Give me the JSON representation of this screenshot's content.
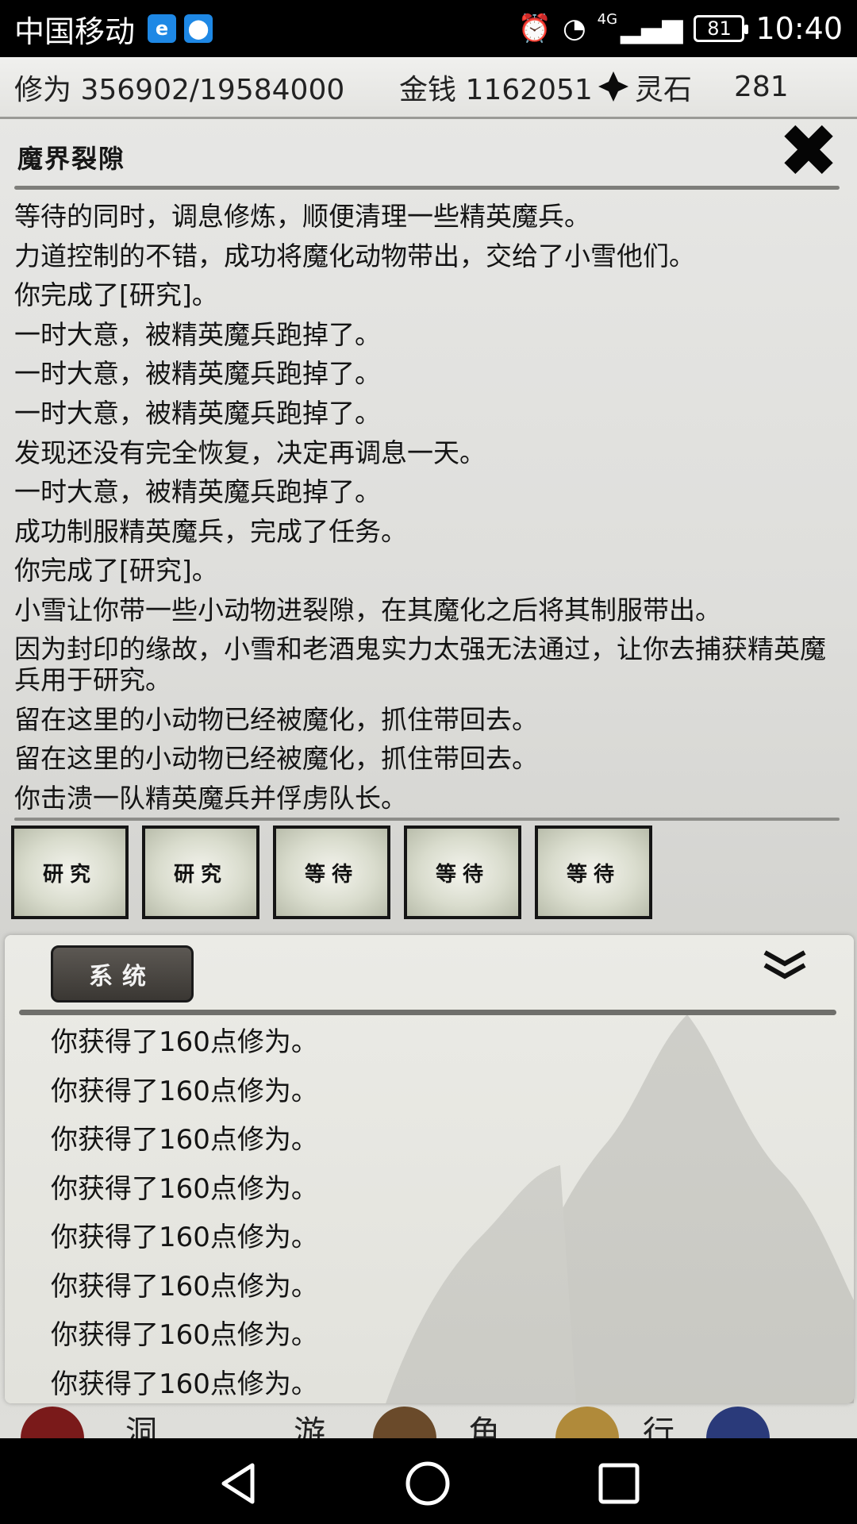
{
  "status_bar": {
    "carrier": "中国移动",
    "network_label": "4G",
    "battery": "81",
    "time": "10:40"
  },
  "resources": {
    "cultivation_label": "修为",
    "cultivation_value": "356902/19584000",
    "money_label": "金钱",
    "money_value": "1162051",
    "stone_label": "灵石",
    "stone_value": "281"
  },
  "panel": {
    "title": "魔界裂隙",
    "close_glyph": "✖"
  },
  "log": [
    "等待的同时，调息修炼，顺便清理一些精英魔兵。",
    "力道控制的不错，成功将魔化动物带出，交给了小雪他们。",
    "你完成了[研究]。",
    "一时大意，被精英魔兵跑掉了。",
    "一时大意，被精英魔兵跑掉了。",
    "一时大意，被精英魔兵跑掉了。",
    "发现还没有完全恢复，决定再调息一天。",
    "一时大意，被精英魔兵跑掉了。",
    "成功制服精英魔兵，完成了任务。",
    "你完成了[研究]。",
    "小雪让你带一些小动物进裂隙，在其魔化之后将其制服带出。",
    "因为封印的缘故，小雪和老酒鬼实力太强无法通过，让你去捕获精英魔兵用于研究。",
    "留在这里的小动物已经被魔化，抓住带回去。",
    "留在这里的小动物已经被魔化，抓住带回去。",
    "你击溃一队精英魔兵并俘虏队长。"
  ],
  "actions": [
    "研究",
    "研究",
    "等待",
    "等待",
    "等待"
  ],
  "system": {
    "tab_label": "系统",
    "messages": [
      "你获得了160点修为。",
      "你获得了160点修为。",
      "你获得了160点修为。",
      "你获得了160点修为。",
      "你获得了160点修为。",
      "你获得了160点修为。",
      "你获得了160点修为。",
      "你获得了160点修为。"
    ]
  },
  "bottom_tabs": [
    "洞",
    "游",
    "角",
    "行"
  ],
  "colors": {
    "status_bar_bg": "#000000",
    "tab_bg": "#4a4641",
    "text": "#141414"
  }
}
